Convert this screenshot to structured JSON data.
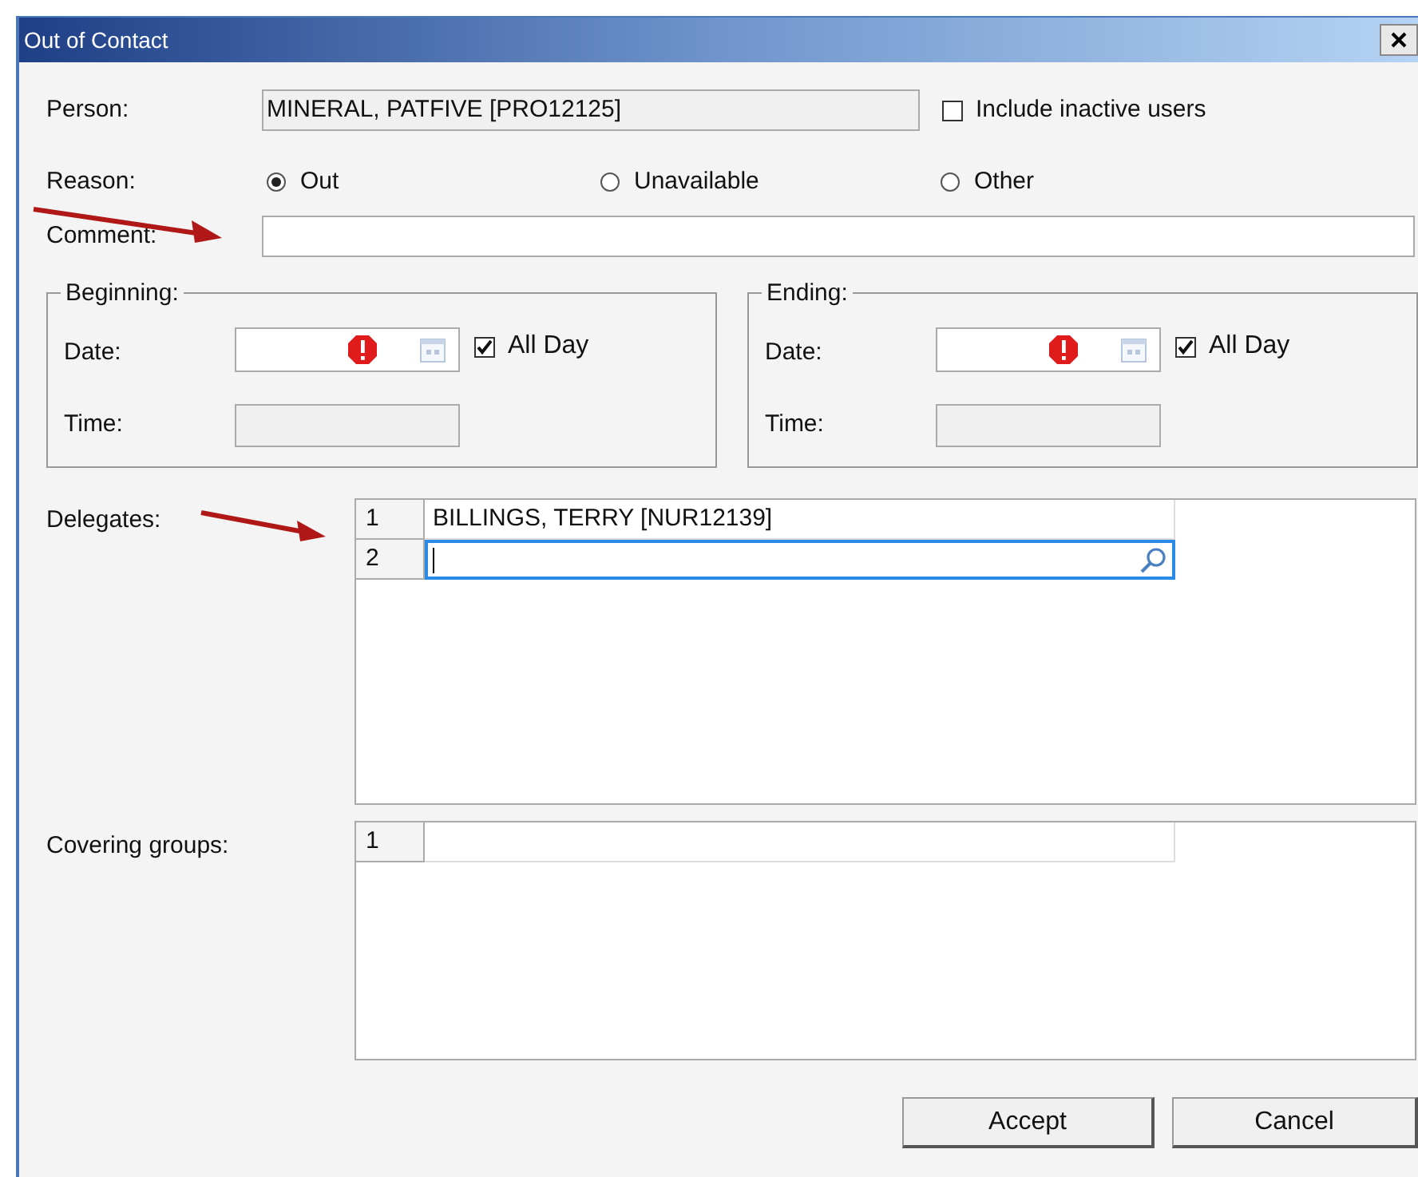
{
  "window": {
    "title": "Out of Contact"
  },
  "person": {
    "label": "Person:",
    "value": "MINERAL, PATFIVE [PRO12125]"
  },
  "include_inactive": {
    "label": "Include inactive users",
    "checked": false
  },
  "reason": {
    "label": "Reason:",
    "options": [
      {
        "label": "Out",
        "selected": true
      },
      {
        "label": "Unavailable",
        "selected": false
      },
      {
        "label": "Other",
        "selected": false
      }
    ]
  },
  "comment": {
    "label": "Comment:"
  },
  "ranges": [
    {
      "label": "Beginning:",
      "date_label": "Date:",
      "time_label": "Time:",
      "all_day": {
        "label": "All Day",
        "checked": true
      }
    },
    {
      "label": "Ending:",
      "date_label": "Date:",
      "time_label": "Time:",
      "all_day": {
        "label": "All Day",
        "checked": true
      }
    }
  ],
  "delegates": {
    "label": "Delegates:",
    "rows": [
      {
        "number": "1",
        "value": "BILLINGS, TERRY [NUR12139]",
        "editing": false
      },
      {
        "number": "2",
        "editing": true
      }
    ]
  },
  "covering_groups": {
    "label": "Covering groups:",
    "rows": [
      {
        "number": "1",
        "editing": false
      }
    ]
  },
  "buttons": [
    {
      "label": "Accept"
    },
    {
      "label": "Cancel"
    }
  ]
}
